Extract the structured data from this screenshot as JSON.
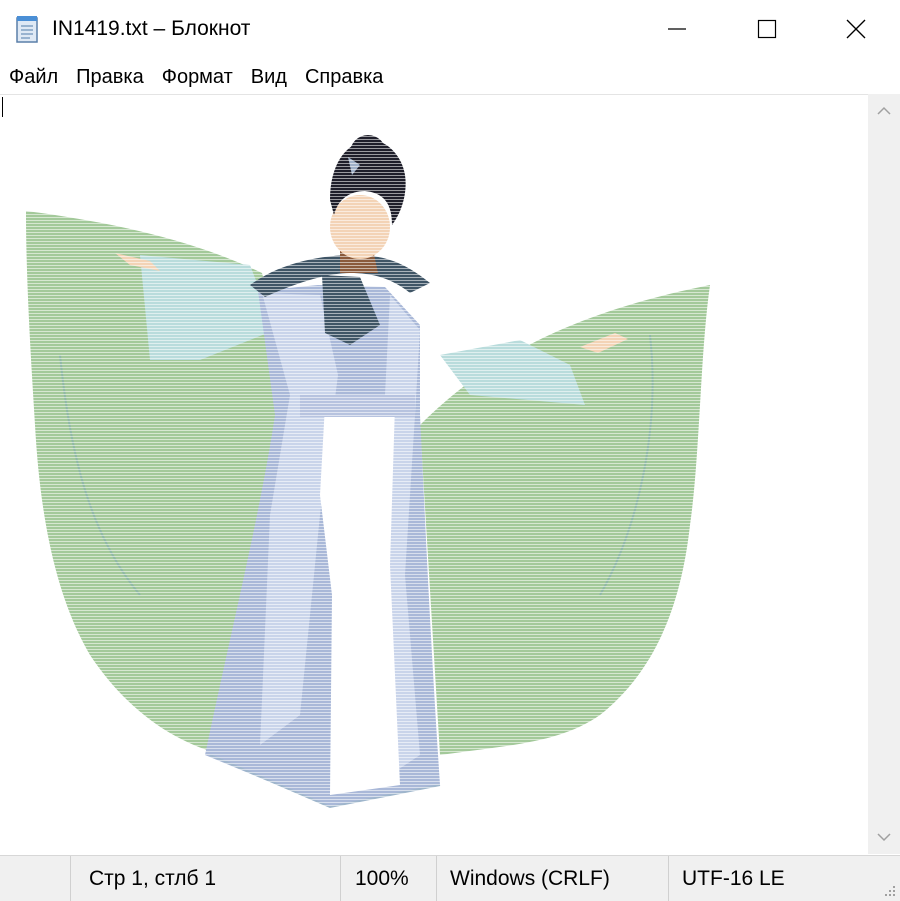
{
  "window": {
    "title": "IN1419.txt – Блокнот",
    "controls": {
      "minimize": "minimize",
      "maximize": "maximize",
      "close": "close"
    }
  },
  "menu": {
    "items": [
      {
        "label": "Файл"
      },
      {
        "label": "Правка"
      },
      {
        "label": "Формат"
      },
      {
        "label": "Вид"
      },
      {
        "label": "Справка"
      }
    ]
  },
  "editor": {
    "content_description_icon": "ascii-art-dancer",
    "colors": {
      "sleeve_green": "#a3c99a",
      "robe_blue": "#a9b8d8",
      "robe_light": "#b9dcdc",
      "hair": "#1e1e2a",
      "collar": "#3f5566",
      "skin": "#f3d3b6",
      "neck": "#8a5a3c"
    }
  },
  "statusbar": {
    "position": "Стр 1, стлб 1",
    "zoom": "100%",
    "line_endings": "Windows (CRLF)",
    "encoding": "UTF-16 LE"
  },
  "icons": {
    "app": "notepad-icon",
    "scroll_up": "chevron-up-icon",
    "scroll_down": "chevron-down-icon",
    "grip": "resize-grip-icon"
  }
}
